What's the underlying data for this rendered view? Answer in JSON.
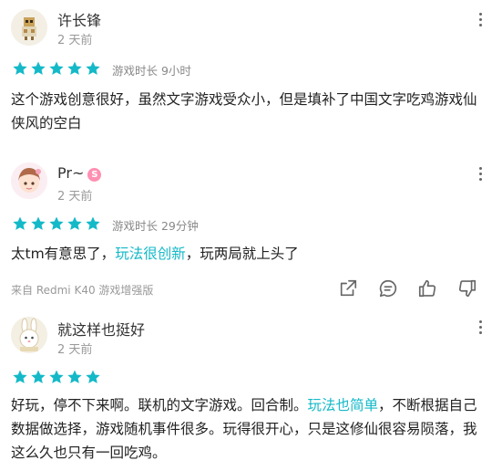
{
  "reviews": [
    {
      "username": "许长锋",
      "date": "2 天前",
      "rating": 5,
      "playtime": "游戏时长 9小时",
      "content": "这个游戏创意很好，虽然文字游戏受众小，但是填补了中国文字吃鸡游戏仙侠风的空白",
      "avatar_icon": "pixel-character-avatar"
    },
    {
      "username": "Pr~",
      "badge": "S",
      "date": "2 天前",
      "rating": 5,
      "playtime": "游戏时长 29分钟",
      "content_parts": [
        "太tm有意思了，",
        "玩法很创新",
        "，玩两局就上头了"
      ],
      "device": "来自 Redmi K40 游戏增强版",
      "avatar_icon": "anime-girl-avatar"
    },
    {
      "username": "就这样也挺好",
      "date": "2 天前",
      "rating": 5,
      "content_parts": [
        "好玩，停不下来啊。联机的文字游戏。回合制。",
        "玩法也简单",
        "，不断根据自己数据做选择，游戏随机事件很多。玩得很开心，只是这修仙很容易陨落，我这么久也只有一回吃鸡。"
      ],
      "avatar_icon": "bunny-avatar"
    }
  ],
  "colors": {
    "star": "#14b9c8",
    "highlight": "#14b9c8",
    "muted_text": "#999999",
    "badge": "#ff8fb3"
  }
}
